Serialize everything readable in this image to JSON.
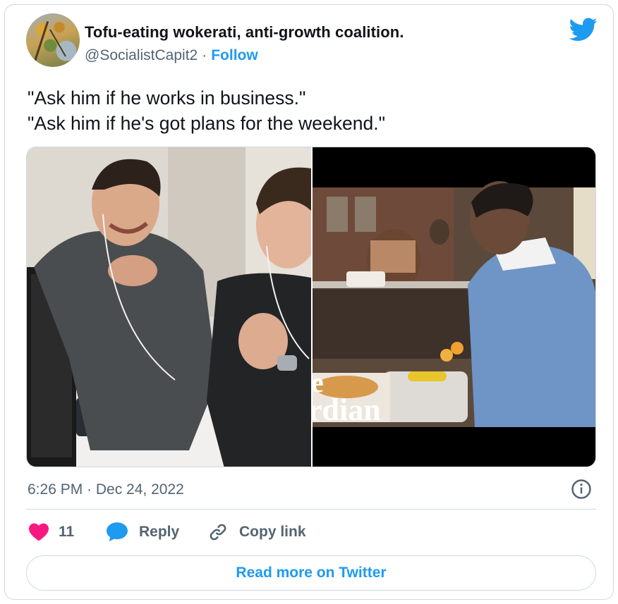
{
  "author": {
    "display_name": "Tofu-eating wokerati, anti-growth coalition.",
    "handle": "@SocialistCapit2",
    "separator": "·",
    "follow_label": "Follow",
    "avatar": "autumn-branches-avatar"
  },
  "tweet": {
    "lines": [
      "\"Ask him if he works in business.\"",
      "\"Ask him if he's got plans for the weekend.\""
    ]
  },
  "media": {
    "left_image": "two-men-laughing-with-earpieces",
    "right_image": "man-in-blue-sweater-at-canteen-counter",
    "watermark": "rdian",
    "watermark_prefix": "e"
  },
  "meta": {
    "timestamp": "6:26 PM · Dec 24, 2022"
  },
  "actions": {
    "like_count": "11",
    "reply_label": "Reply",
    "copy_label": "Copy link"
  },
  "footer": {
    "read_more_label": "Read more on Twitter"
  },
  "colors": {
    "accent": "#1d9bf0",
    "like": "#f91880",
    "muted": "#536471",
    "border": "#cfd9de"
  },
  "icons": {
    "brand": "twitter-bird-icon",
    "info": "info-icon",
    "like": "heart-icon",
    "reply": "speech-bubble-icon",
    "copy": "link-icon"
  }
}
